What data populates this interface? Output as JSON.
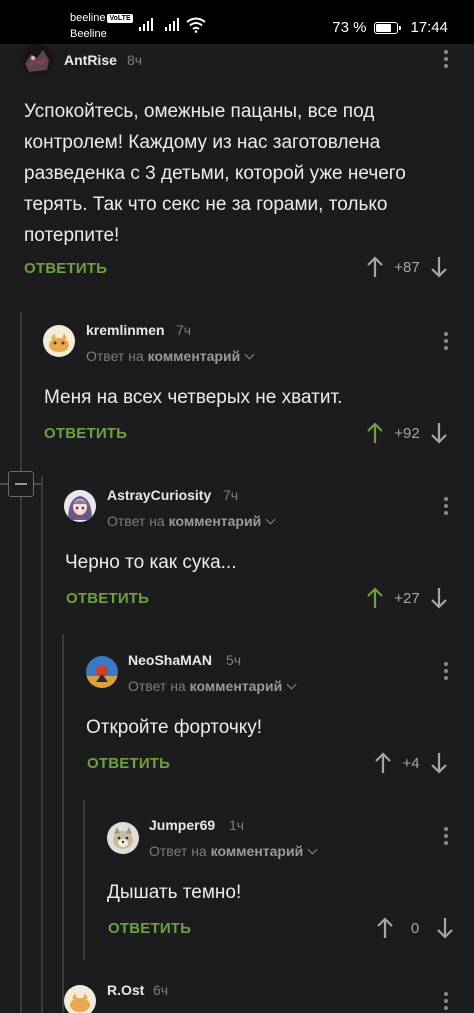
{
  "status_bar": {
    "carrier_top": "beeline",
    "volte": "VoLTE",
    "carrier_bottom": "Beeline",
    "battery": "73 %",
    "battery_level": 0.73,
    "time": "17:44"
  },
  "comments": [
    {
      "username": "AntRise",
      "time": "8ч",
      "text": "Успокойтесь, омежные пацаны, все под контролем! Каждому из нас заготовлена разведенка с 3 детьми, которой уже нечего терять. Так что секс не за горами, только потерпите!",
      "reply_label": "ОТВЕТИТЬ",
      "score": "+87"
    },
    {
      "username": "kremlinmen",
      "time": "7ч",
      "reply_prefix": "Ответ на",
      "reply_target": "комментарий",
      "text": "Меня на всех четверых не хватит.",
      "reply_label": "ОТВЕТИТЬ",
      "score": "+92",
      "upvoted": true
    },
    {
      "username": "AstrayCuriosity",
      "time": "7ч",
      "reply_prefix": "Ответ на",
      "reply_target": "комментарий",
      "text": "Черно то как сука...",
      "reply_label": "ОТВЕТИТЬ",
      "score": "+27",
      "upvoted": true
    },
    {
      "username": "NeoShaMAN",
      "time": "5ч",
      "reply_prefix": "Ответ на",
      "reply_target": "комментарий",
      "text": "Откройте форточку!",
      "reply_label": "ОТВЕТИТЬ",
      "score": "+4"
    },
    {
      "username": "Jumper69",
      "time": "1ч",
      "reply_prefix": "Ответ на",
      "reply_target": "комментарий",
      "text": "Дышать темно!",
      "reply_label": "ОТВЕТИТЬ",
      "score": "0"
    },
    {
      "username": "R.Ost",
      "time": "6ч"
    }
  ],
  "colors": {
    "background": "#1c1c1e",
    "accent_green": "#6f9f3f",
    "muted": "#7d7d7d"
  }
}
